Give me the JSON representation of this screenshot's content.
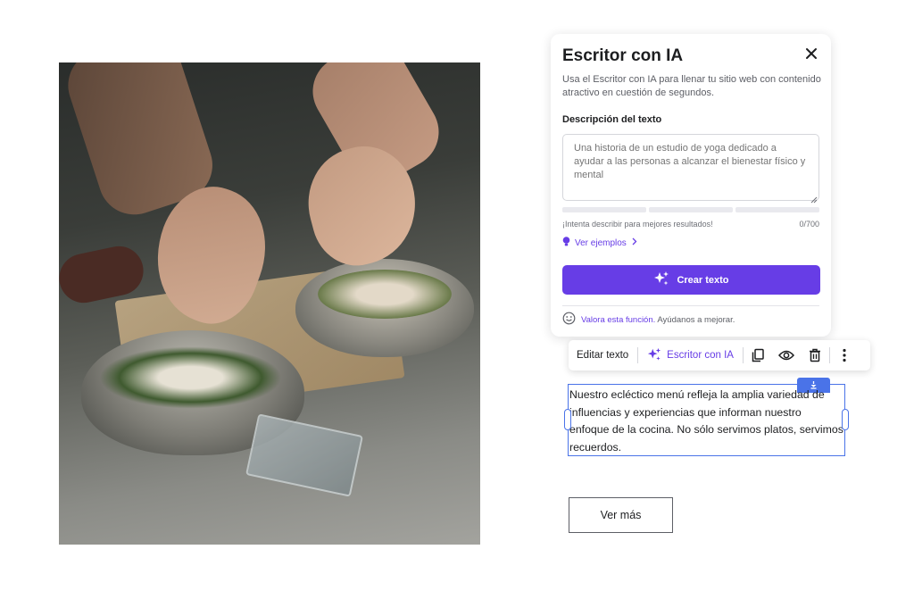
{
  "ai_writer": {
    "title": "Escritor con IA",
    "description": "Usa el Escritor con IA para llenar tu sitio web con contenido atractivo en cuestión de segundos.",
    "field_label": "Descripción del texto",
    "textarea_placeholder": "Una historia de un estudio de yoga dedicado a ayudar a las personas a alcanzar el bienestar físico y mental",
    "hint": "¡Intenta describir para mejores resultados!",
    "counter": "0/700",
    "examples_link": "Ver ejemplos",
    "create_button": "Crear texto",
    "feedback_link": "Valora esta función.",
    "feedback_text": "Ayúdanos a mejorar.",
    "icons": [
      "close-icon",
      "bulb-icon",
      "chevron-right-icon",
      "sparkle-icon",
      "smiley-icon"
    ]
  },
  "toolbar": {
    "edit_text": "Editar texto",
    "ai_writer": "Escritor con IA",
    "icons": [
      "sparkle-icon",
      "duplicate-icon",
      "eye-icon",
      "trash-icon",
      "more-vertical-icon"
    ]
  },
  "content": {
    "paragraph": "Nuestro ecléctico menú refleja la amplia variedad de influencias y experiencias que informan nuestro enfoque de la cocina. No sólo servimos platos, servimos recuerdos.",
    "more_button": "Ver más"
  },
  "colors": {
    "accent": "#673de6",
    "selection": "#4a73e8",
    "text": "#1d1e20"
  }
}
